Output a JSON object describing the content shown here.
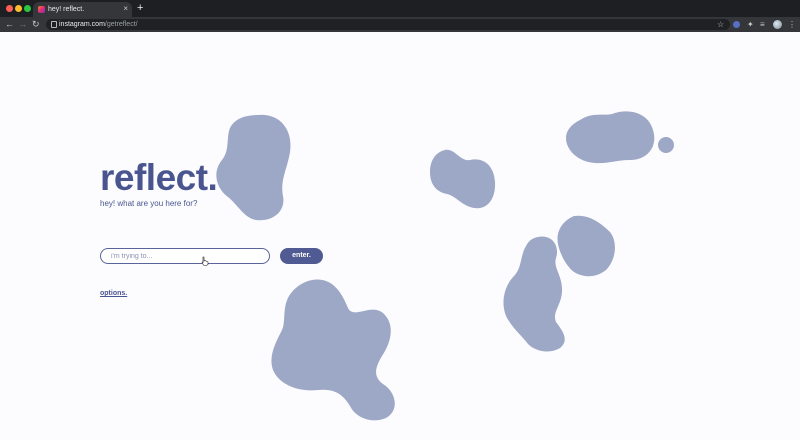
{
  "browser": {
    "tab_title": "hey! reflect.",
    "tab_close": "×",
    "new_tab": "+",
    "url_host": "instagram.com",
    "url_path": "/getreflect/",
    "icons": [
      "back-icon",
      "forward-icon",
      "reload-icon",
      "lock-icon",
      "star-icon",
      "extension-shield-icon",
      "puzzle-icon",
      "queue-icon",
      "profile-avatar",
      "menu-icon"
    ]
  },
  "page": {
    "title": "reflect.",
    "subtitle": "hey! what are you here for?",
    "input_placeholder": "i'm trying to...",
    "input_value": "",
    "enter_label": "enter.",
    "options_label": "options."
  },
  "colors": {
    "background": "#fcfcfe",
    "primary": "#4a5590",
    "button": "#505a93",
    "blob": "#9da8c7"
  }
}
